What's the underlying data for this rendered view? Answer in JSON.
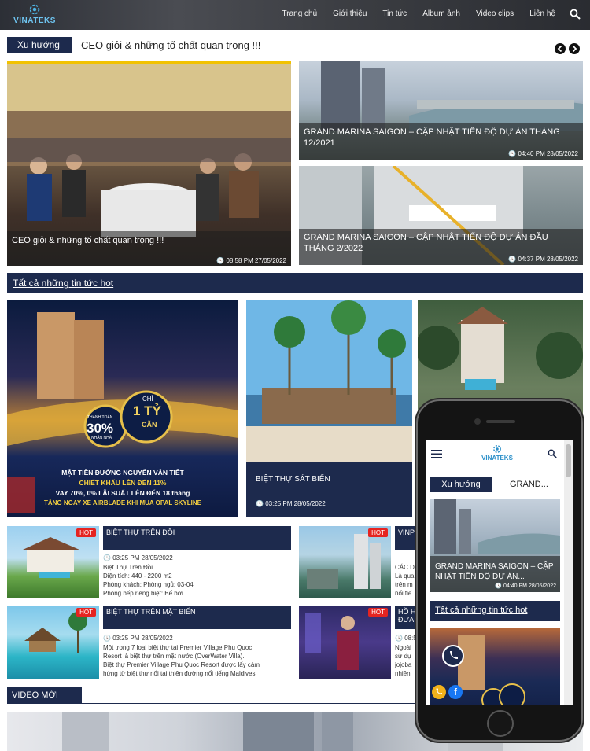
{
  "header": {
    "logo_text": "VINATEKS",
    "nav": [
      "Trang chủ",
      "Giới thiệu",
      "Tin tức",
      "Album ảnh",
      "Video clips",
      "Liên hệ"
    ]
  },
  "ticker": {
    "label": "Xu hướng",
    "text": "CEO giỏi & những tố chất quan trọng !!!"
  },
  "featured": {
    "title": "CEO giỏi & những tố chất quan trọng !!!",
    "time": "08:58 PM 27/05/2022"
  },
  "side_cards": [
    {
      "title": "GRAND MARINA SAIGON – CẬP NHẬT TIẾN ĐỘ DỰ ÁN THÁNG 12/2021",
      "time": "04:40 PM 28/05/2022"
    },
    {
      "title": "GRAND MARINA SAIGON – CẬP NHẬT TIẾN ĐỘ DỰ ÁN ĐẦU THÁNG 2/2022",
      "time": "04:37 PM 28/05/2022"
    }
  ],
  "hot_news_label": "Tất cả những tin tức hot",
  "promo": {
    "badge_top": "THANH TOÁN",
    "badge_pct": "30%",
    "badge_bottom": "NHẬN NHÀ",
    "badge_chi": "CHỈ",
    "badge_ty": "1 TỶ",
    "badge_can": "CĂN",
    "line1": "MẶT TIỀN ĐƯỜNG NGUYỄN VĂN TIẾT",
    "line2": "CHIẾT KHẤU LÊN ĐẾN 11%",
    "line3": "VAY 70%, 0% LÃI SUẤT LÊN ĐẾN 18 tháng",
    "line4": "TẶNG NGAY XE AIRBLADE KHI MUA OPAL SKYLINE"
  },
  "beach_card": {
    "title": "BIỆT THỰ SÁT BIỂN",
    "time": "03:25 PM 28/05/2022"
  },
  "list_items": [
    {
      "tag": "HOT",
      "title": "BIỆT THỰ TRÊN ĐỒI",
      "time": "03:25 PM 28/05/2022",
      "lines": [
        "Biệt Thự Trên Đồi",
        "Diện tích: 440 - 2200 m2",
        "Phòng khách: Phòng ngủ: 03-04",
        "Phòng bếp riêng biệt: Bể bơi"
      ]
    },
    {
      "tag": "HOT",
      "title": "BIỆT THỰ TRÊN MẶT BIỂN",
      "time": "03:25 PM 28/05/2022",
      "lines": [
        "Một trong 7 loại biệt thự tại Premier Village Phu Quoc",
        "Resort là biệt thự trên mặt nước (OverWater Villa).",
        "Biệt thự Premier Village Phu Quoc Resort được lấy cảm",
        "hứng từ biệt thự nổi tại thiên đường nổi tiếng Maldives."
      ]
    },
    {
      "tag": "HOT",
      "title": "VINPI",
      "time": "",
      "lines": [
        "CÁC D",
        "Là qua",
        "trên m",
        "nổi tiế"
      ]
    },
    {
      "tag": "HOT",
      "title": "HỒ H",
      "title2": "ĐƯA",
      "time": "08:5",
      "lines": [
        "Ngoài",
        "sử dụ",
        "jojoba",
        "nhiên"
      ]
    }
  ],
  "video_section_label": "VIDEO MỚI",
  "phone": {
    "logo_text": "VINATEKS",
    "ticker_label": "Xu hướng",
    "ticker_text": "GRAND...",
    "card_title": "GRAND MARINA SAIGON – CẬP NHẬT TIẾN ĐỘ DỰ ÁN...",
    "card_time": "04:40 PM 28/05/2022",
    "hot_label": "Tất cả những tin tức hot"
  },
  "colors": {
    "navy": "#1d2a4d",
    "hot_red": "#e52421",
    "gold": "#f2c200"
  }
}
